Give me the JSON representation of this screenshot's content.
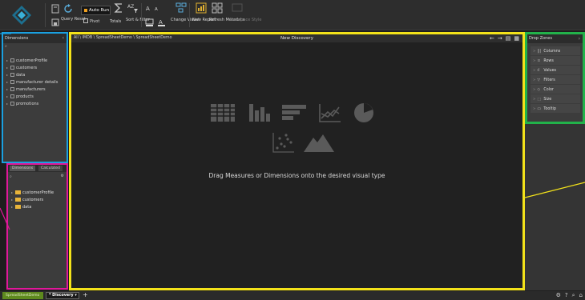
{
  "ribbon": {
    "auto_run_label": "Auto Run",
    "query_reset_label": "Query Reset",
    "pivot_label": "Pivot",
    "totals_label": "Totals",
    "sort_filter_label": "Sort & Filter",
    "change_visual_label": "Change Visual",
    "new_report_label": "New Report",
    "refresh_metadata_label": "Refresh Metadata",
    "workspace_label": "Workspace Style",
    "font_a_large": "A",
    "font_a_small": "A"
  },
  "dimensions_panel": {
    "title": "Dimensions",
    "search_glyph": "⌕",
    "items": [
      {
        "label": "customerProfile"
      },
      {
        "label": "customers"
      },
      {
        "label": "data"
      },
      {
        "label": "manufacturer details"
      },
      {
        "label": "manufacturers"
      },
      {
        "label": "products"
      },
      {
        "label": "promotions"
      }
    ]
  },
  "data_panel": {
    "tab_1": "Dimensions",
    "tab_2": "Calculated",
    "folders": [
      {
        "label": "customerProfile"
      },
      {
        "label": "customers"
      },
      {
        "label": "data"
      }
    ]
  },
  "canvas": {
    "breadcrumb": "All \\ IMDB \\ SpreadSheetDemo \\ SpreadSheetDemo",
    "title": "New Discovery",
    "hint": "Drag Measures or Dimensions onto the desired visual type"
  },
  "drop_zones": {
    "title": "Drop Zones",
    "items": [
      {
        "icon": "|||",
        "label": "Columns"
      },
      {
        "icon": "≡",
        "label": "Rows"
      },
      {
        "icon": "ıl",
        "label": "Values"
      },
      {
        "icon": "▽",
        "label": "Filters"
      },
      {
        "icon": "◇",
        "label": "Color"
      },
      {
        "icon": "⬚",
        "label": "Size"
      },
      {
        "icon": "▭",
        "label": "Tooltip"
      }
    ]
  },
  "statusbar": {
    "tab_1": "SpreadSheetDemo",
    "tab_2": "* Discovery ▾",
    "plus": "+"
  },
  "colors": {
    "dimensions_outline": "#1aa0e0",
    "data_outline": "#e0189a",
    "canvas_outline": "#f3e21a",
    "dropzones_outline": "#22b24a",
    "folder": "#e8b43a",
    "active_tab": "#5e8a1e"
  }
}
